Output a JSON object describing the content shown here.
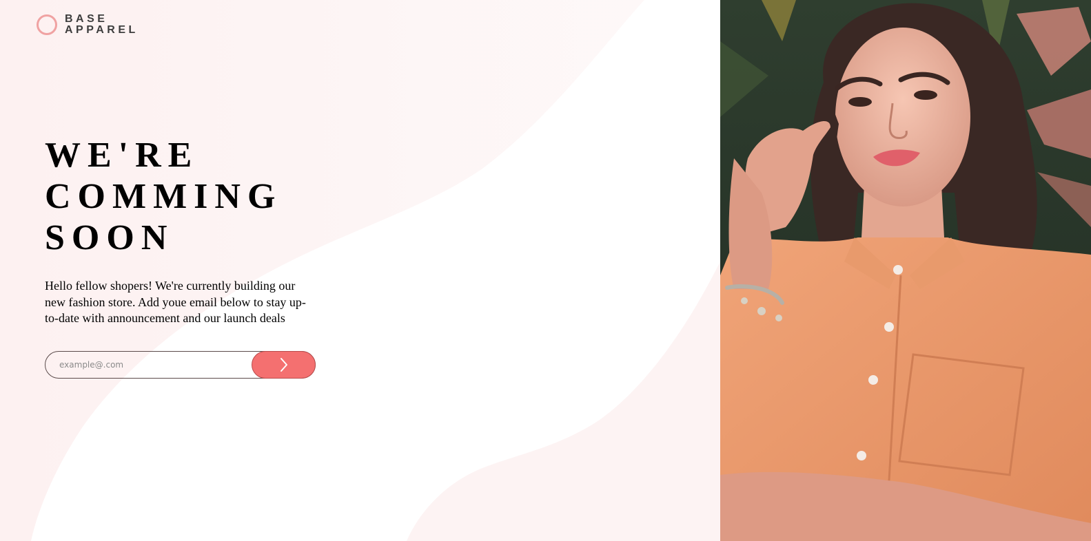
{
  "brand": {
    "line1": "BASE",
    "line2": "APPAREL",
    "logo_icon": "circle-ring-icon",
    "accent_color": "#f0a2a2"
  },
  "hero": {
    "headline_line1": "WE'RE",
    "headline_line2": "COMMING",
    "headline_line3": "SOON",
    "description": "Hello fellow shopers! We're currently building our new fashion store. Add youe email below to stay up-to-date with announcement and our launch deals"
  },
  "form": {
    "email_placeholder": "example@.com",
    "email_value": "",
    "submit_icon": "chevron-right-icon",
    "button_color": "#f47070"
  },
  "photo": {
    "subject_icon": "woman-in-orange-shirt-photo"
  }
}
